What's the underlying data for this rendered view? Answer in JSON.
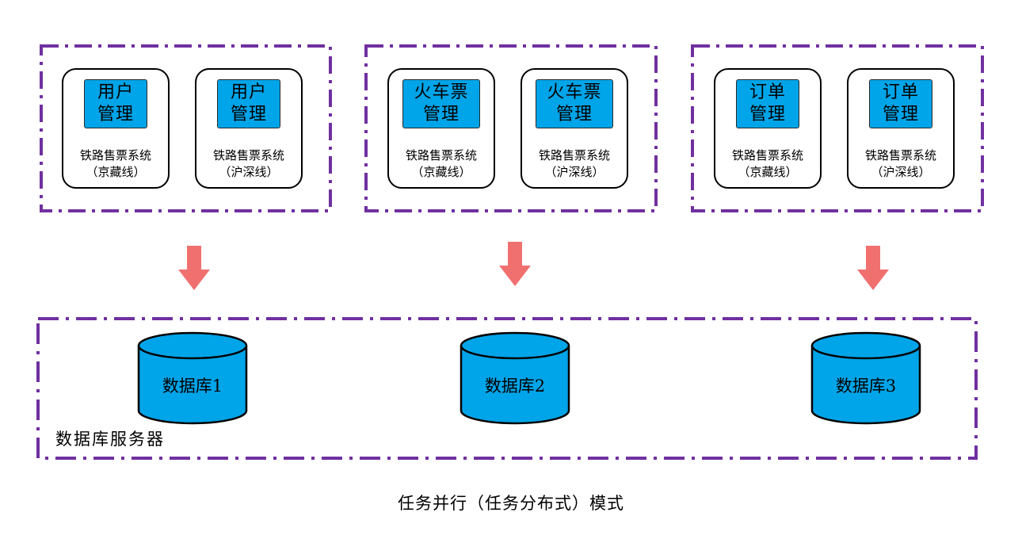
{
  "colors": {
    "frame": "#7030a0",
    "module_fill": "#00a4e8",
    "db_fill": "#00a4e8",
    "arrow": "#f07070",
    "outline": "#000000"
  },
  "groups": [
    {
      "module": "用户\n管理",
      "systems": [
        {
          "name": "铁路售票系统",
          "line": "（京藏线）"
        },
        {
          "name": "铁路售票系统",
          "line": "（沪深线）"
        }
      ]
    },
    {
      "module": "火车票\n管理",
      "systems": [
        {
          "name": "铁路售票系统",
          "line": "（京藏线）"
        },
        {
          "name": "铁路售票系统",
          "line": "（沪深线）"
        }
      ]
    },
    {
      "module": "订单\n管理",
      "systems": [
        {
          "name": "铁路售票系统",
          "line": "（京藏线）"
        },
        {
          "name": "铁路售票系统",
          "line": "（沪深线）"
        }
      ]
    }
  ],
  "databases": [
    "数据库1",
    "数据库2",
    "数据库3"
  ],
  "server_label": "数据库服务器",
  "caption": "任务并行（任务分布式）模式"
}
